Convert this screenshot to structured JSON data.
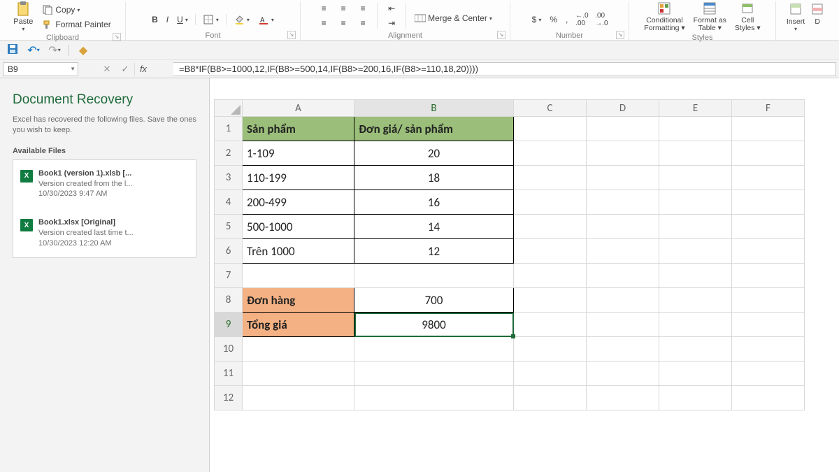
{
  "ribbon": {
    "clipboard": {
      "label": "Clipboard",
      "paste": "Paste",
      "copy": "Copy",
      "format_painter": "Format Painter"
    },
    "font": {
      "label": "Font",
      "bold": "B",
      "italic": "I",
      "underline": "U"
    },
    "alignment": {
      "label": "Alignment",
      "merge": "Merge & Center"
    },
    "number": {
      "label": "Number",
      "currency": "$",
      "percent": "%",
      "comma": ",",
      "inc_dec": ".0",
      "dec_dec": ".00"
    },
    "styles": {
      "label": "Styles",
      "cond": "Conditional Formatting",
      "table": "Format as Table",
      "cell": "Cell Styles"
    },
    "cells": {
      "insert": "Insert",
      "delete": "D"
    }
  },
  "qat": {},
  "formula_bar": {
    "cell_ref": "B9",
    "formula": "=B8*IF(B8>=1000,12,IF(B8>=500,14,IF(B8>=200,16,IF(B8>=110,18,20))))"
  },
  "recovery": {
    "title": "Document Recovery",
    "desc": "Excel has recovered the following files. Save the ones you wish to keep.",
    "available": "Available Files",
    "files": [
      {
        "name": "Book1 (version 1).xlsb  [...",
        "sub": "Version created from the l...",
        "ts": "10/30/2023 9:47 AM"
      },
      {
        "name": "Book1.xlsx  [Original]",
        "sub": "Version created last time t...",
        "ts": "10/30/2023 12:20 AM"
      }
    ]
  },
  "grid": {
    "columns": [
      "A",
      "B",
      "C",
      "D",
      "E",
      "F"
    ],
    "header": {
      "A": "Sản phẩm",
      "B": "Đơn giá/ sản phẩm"
    },
    "rows": [
      {
        "A": "1-109",
        "B": "20"
      },
      {
        "A": "110-199",
        "B": "18"
      },
      {
        "A": "200-499",
        "B": "16"
      },
      {
        "A": "500-1000",
        "B": "14"
      },
      {
        "A": "Trên 1000",
        "B": "12"
      }
    ],
    "order": {
      "A": "Đơn hàng",
      "B": "700"
    },
    "total": {
      "A": "Tổng giá",
      "B": "9800"
    }
  }
}
